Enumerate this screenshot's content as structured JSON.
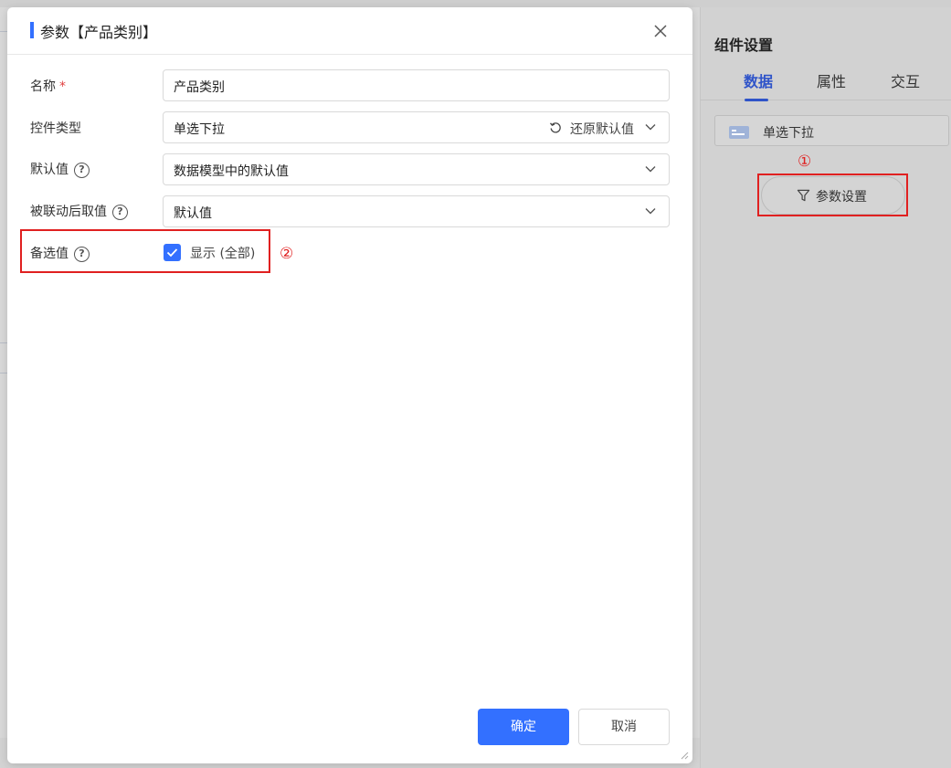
{
  "dialog": {
    "title": "参数【产品类别】",
    "fields": {
      "name": {
        "label": "名称",
        "required_mark": "*",
        "value": "产品类别"
      },
      "control_type": {
        "label": "控件类型",
        "value": "单选下拉",
        "reset_label": "还原默认值"
      },
      "default_value": {
        "label": "默认值",
        "value": "数据模型中的默认值"
      },
      "linked_value": {
        "label": "被联动后取值",
        "value": "默认值"
      },
      "options": {
        "label": "备选值",
        "checkbox_label": "显示 (全部)",
        "checked": true
      }
    },
    "help_glyph": "?",
    "confirm_label": "确定",
    "cancel_label": "取消"
  },
  "panel": {
    "title": "组件设置",
    "tabs": [
      {
        "label": "数据",
        "active": true
      },
      {
        "label": "属性",
        "active": false
      },
      {
        "label": "交互",
        "active": false
      }
    ],
    "component_label": "单选下拉",
    "param_button_label": "参数设置"
  },
  "annotations": {
    "marker_1": "①",
    "marker_2": "②"
  },
  "colors": {
    "accent": "#3370ff",
    "tab_active": "#2f54c9",
    "annotation": "#e02020"
  }
}
